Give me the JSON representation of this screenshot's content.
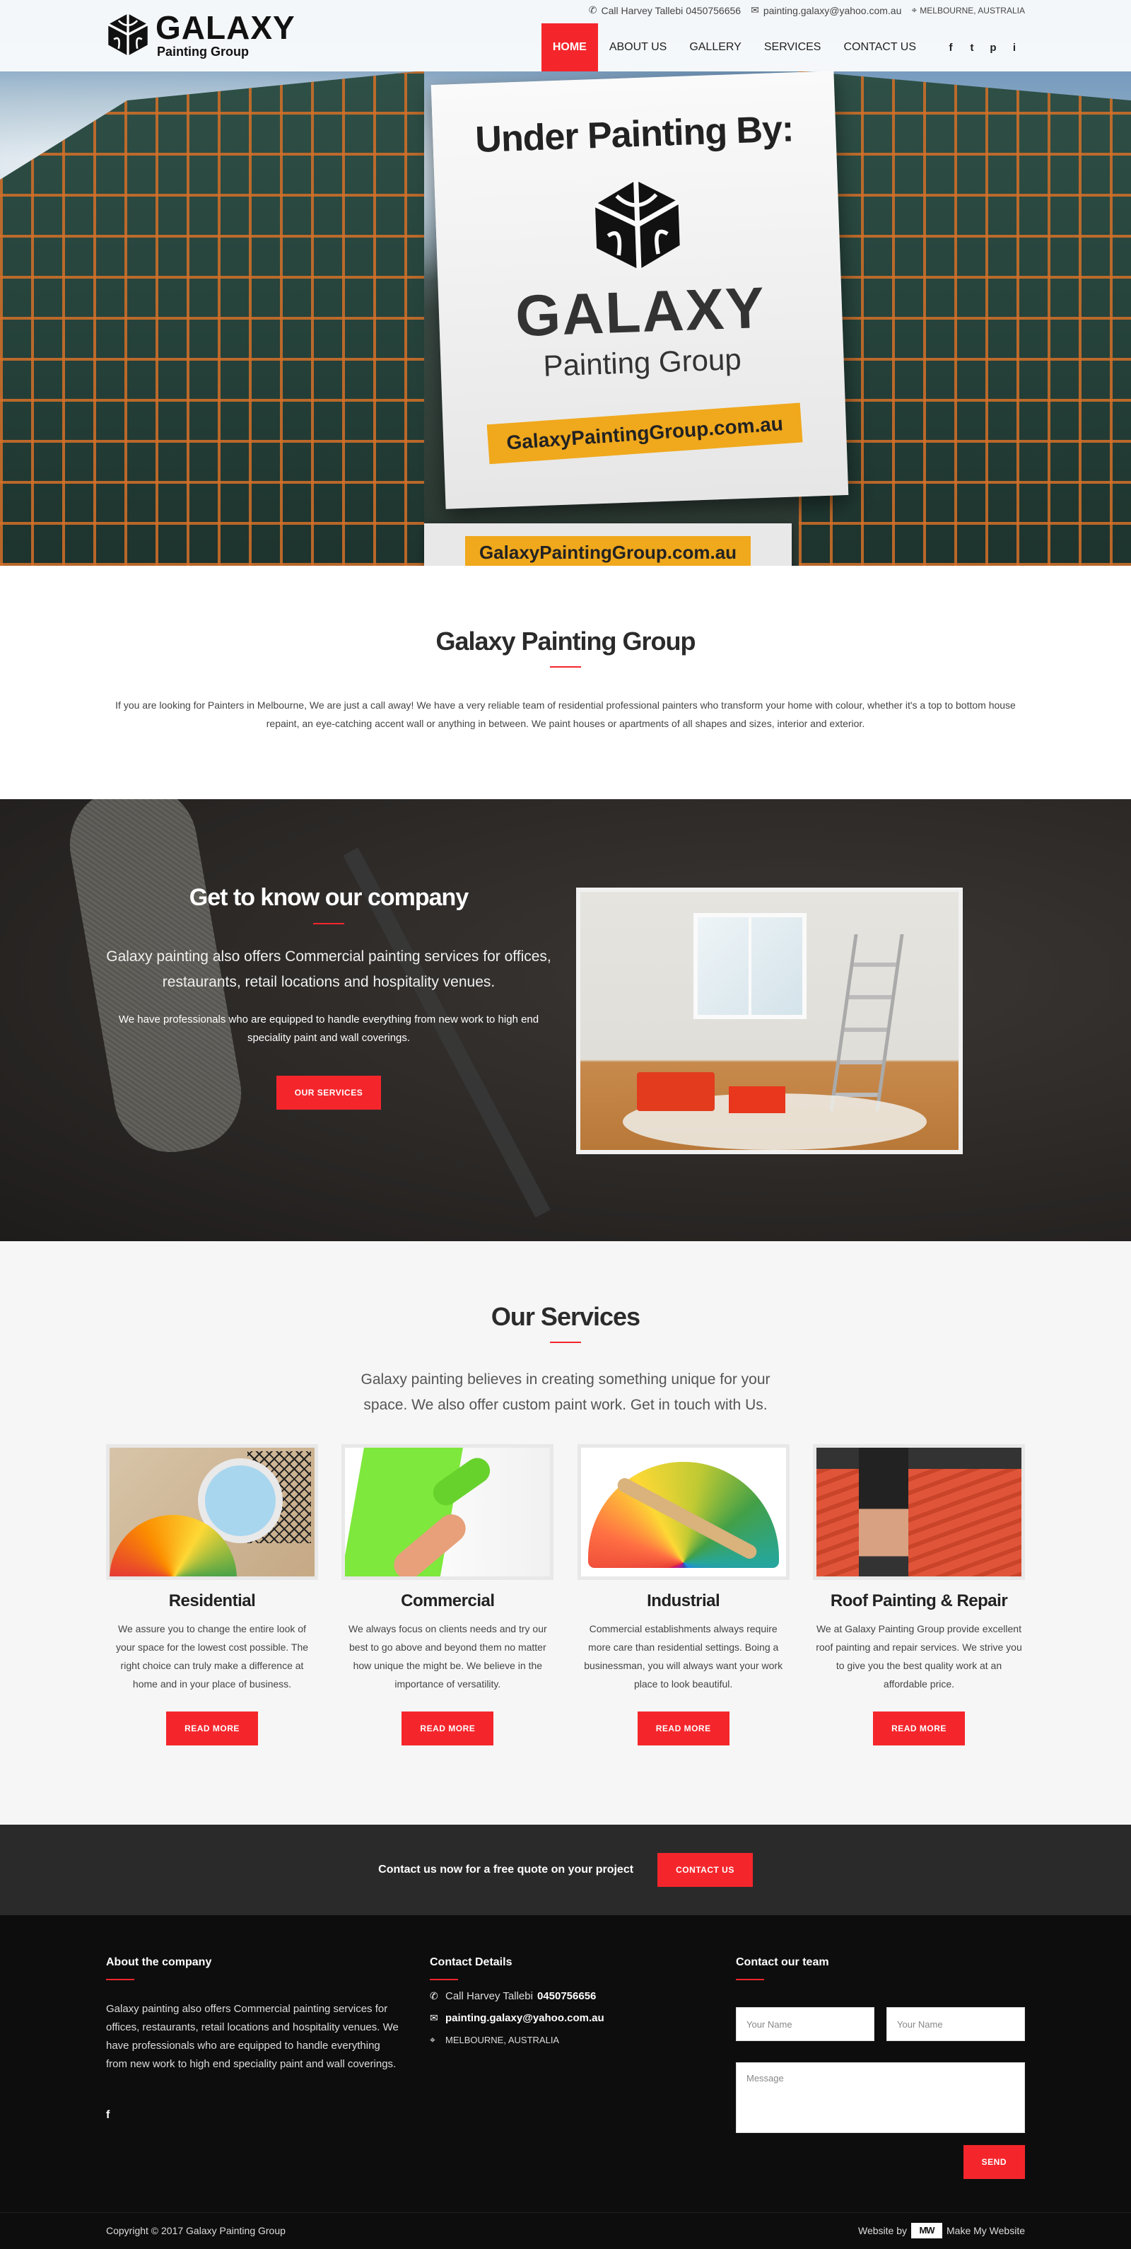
{
  "header": {
    "logo_title": "GALAXY",
    "logo_sub": "Painting Group",
    "topbar": {
      "phone_label": "Call Harvey Tallebi",
      "phone_number": "0450756656",
      "email": "painting.galaxy@yahoo.com.au",
      "location": "MELBOURNE, AUSTRALIA"
    },
    "nav": [
      {
        "label": "HOME",
        "active": true
      },
      {
        "label": "ABOUT US"
      },
      {
        "label": "GALLERY"
      },
      {
        "label": "SERVICES"
      },
      {
        "label": "CONTACT US"
      }
    ],
    "social": [
      "f",
      "t",
      "p",
      "i"
    ]
  },
  "hero": {
    "banner_heading": "Under Painting By:",
    "banner_brand": "GALAXY",
    "banner_sub": "Painting Group",
    "banner_url": "GalaxyPaintingGroup.com.au",
    "banner_url_2": "GalaxyPaintingGroup.com.au"
  },
  "intro": {
    "title": "Galaxy Painting Group",
    "text": "If you are looking for Painters in Melbourne, We are just a call away! We have a very reliable team of residential professional painters who transform your home with colour, whether it's a top to bottom house repaint, an eye-catching accent wall or anything in between. We paint houses or apartments of all shapes and sizes, interior and exterior."
  },
  "company": {
    "title": "Get to know our company",
    "lead": "Galaxy painting also offers Commercial painting services for offices, restaurants, retail locations and hospitality venues.",
    "small": "We have professionals who are equipped to handle everything from new work to high end speciality paint and wall coverings.",
    "button": "OUR SERVICES"
  },
  "services": {
    "title": "Our Services",
    "sub": "Galaxy painting believes in creating something unique for your space. We also offer custom paint work. Get in touch with Us.",
    "cards": [
      {
        "title": "Residential",
        "text": "We assure you to change the entire look of your space for the lowest cost possible. The right choice can truly make a difference at home and in your place of business.",
        "button": "READ MORE"
      },
      {
        "title": "Commercial",
        "text": "We always focus on clients needs and try our best to go above and beyond them no matter how unique the might be. We believe in the importance of versatility.",
        "button": "READ MORE"
      },
      {
        "title": "Industrial",
        "text": "Commercial establishments always require more care than residential settings. Boing a businessman, you will always want your work place to look beautiful.",
        "button": "READ MORE"
      },
      {
        "title": "Roof Painting & Repair",
        "text": "We at Galaxy Painting Group provide excellent roof painting and repair services. We strive you to give you the best quality work at an affordable price.",
        "button": "READ MORE"
      }
    ]
  },
  "cta": {
    "text": "Contact us now for a free quote on your project",
    "button": "CONTACT US"
  },
  "footer": {
    "about": {
      "title": "About the company",
      "text": "Galaxy painting also offers Commercial painting services for offices, restaurants, retail locations and hospitality venues. We have professionals who are equipped to handle everything from new work to high end speciality paint and wall coverings.",
      "social": "f"
    },
    "details": {
      "title": "Contact Details",
      "phone_label": "Call Harvey Tallebi",
      "phone_number": "0450756656",
      "email": "painting.galaxy@yahoo.com.au",
      "location": "MELBOURNE, AUSTRALIA"
    },
    "form": {
      "title": "Contact our team",
      "name_placeholder": "Your Name",
      "name2_placeholder": "Your Name",
      "message_placeholder": "Message",
      "button": "SEND"
    }
  },
  "bottom": {
    "copyright": "Copyright © 2017 Galaxy Painting Group",
    "credit_prefix": "Website by",
    "credit_logo": "MW",
    "credit_name": "Make My Website"
  },
  "colors": {
    "accent": "#f4262c",
    "dark": "#2a2a2a",
    "footer": "#0d0d0d"
  }
}
